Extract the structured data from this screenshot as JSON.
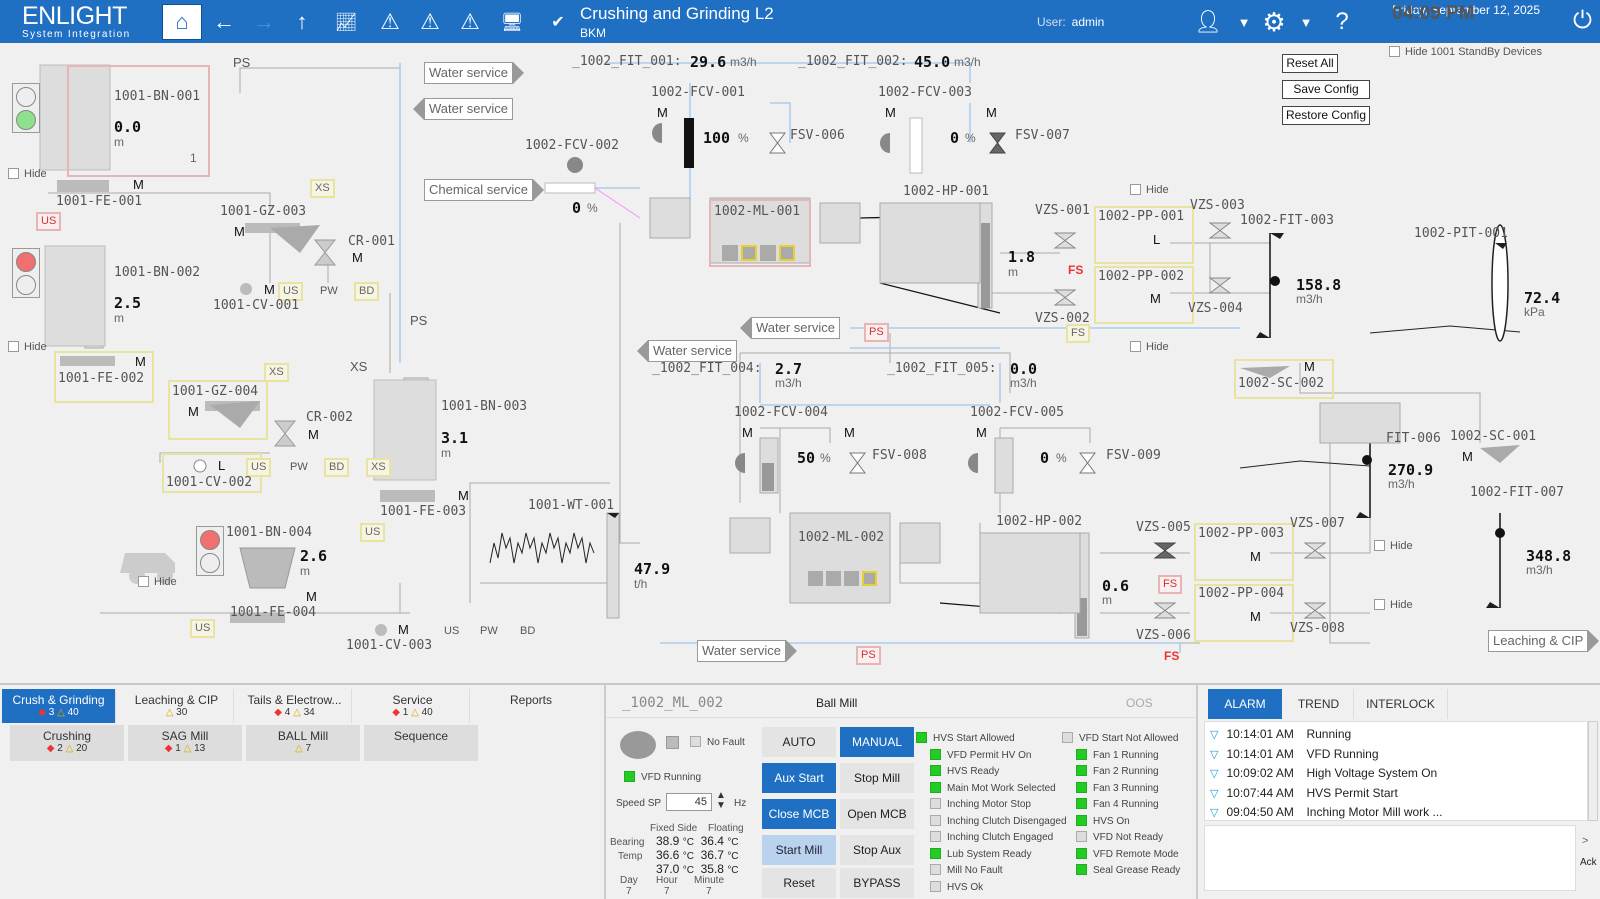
{
  "header": {
    "logo_main": "ENLIGHT",
    "logo_sub": "System Integration",
    "title": "Crushing and Grinding L2",
    "subtitle": "BKM",
    "user_label": "User:",
    "user_name": "admin",
    "time": "04:09 PM",
    "date": "Friday, September 12, 2025"
  },
  "right_controls": {
    "hide_standby": "Hide 1001 StandBy Devices",
    "reset_all": "Reset All",
    "save_config": "Save Config",
    "restore_config": "Restore Config"
  },
  "labels": {
    "ps": "PS",
    "xs": "XS",
    "us": "US",
    "pw": "PW",
    "bd": "BD",
    "fs": "FS",
    "m": "M",
    "l": "L",
    "hide": "Hide",
    "m_unit": "m",
    "one": "1",
    "water_service": "Water service",
    "chemical_service": "Chemical service",
    "leaching_cip": "Leaching & CIP",
    "pct": "%",
    "m3h": "m3/h",
    "kpa": "kPa",
    "th": "t/h"
  },
  "tags": {
    "bn001": "1001-BN-001",
    "bn002": "1001-BN-002",
    "bn003": "1001-BN-003",
    "bn004": "1001-BN-004",
    "fe001": "1001-FE-001",
    "fe002": "1001-FE-002",
    "fe003": "1001-FE-003",
    "fe004": "1001-FE-004",
    "gz003": "1001-GZ-003",
    "gz004": "1001-GZ-004",
    "cr001": "CR-001",
    "cr002": "CR-002",
    "cv001": "1001-CV-001",
    "cv002": "1001-CV-002",
    "cv003": "1001-CV-003",
    "wt001": "1001-WT-001",
    "fcv001": "1002-FCV-001",
    "fcv002": "1002-FCV-002",
    "fcv003": "1002-FCV-003",
    "fcv004": "1002-FCV-004",
    "fcv005": "1002-FCV-005",
    "fsv006": "FSV-006",
    "fsv007": "FSV-007",
    "fsv008": "FSV-008",
    "fsv009": "FSV-009",
    "ml001": "1002-ML-001",
    "ml002": "1002-ML-002",
    "hp001": "1002-HP-001",
    "hp002": "1002-HP-002",
    "pp001": "1002-PP-001",
    "pp002": "1002-PP-002",
    "pp003": "1002-PP-003",
    "pp004": "1002-PP-004",
    "vzs001": "VZS-001",
    "vzs002": "VZS-002",
    "vzs003": "VZS-003",
    "vzs004": "VZS-004",
    "vzs005": "VZS-005",
    "vzs006": "VZS-006",
    "vzs007": "VZS-007",
    "vzs008": "VZS-008",
    "fit003": "1002-FIT-003",
    "fit006": "FIT-006",
    "fit007": "1002-FIT-007",
    "pit001": "1002-PIT-001",
    "sc001": "1002-SC-001",
    "sc002": "1002-SC-002",
    "fit001": "_1002_FIT_001:",
    "fit002": "_1002_FIT_002:",
    "fit004": "_1002_FIT_004:",
    "fit005": "_1002_FIT_005:"
  },
  "values": {
    "bn001": "0.0",
    "bn002": "2.5",
    "bn003": "3.1",
    "bn004": "2.6",
    "fit001": "29.6",
    "fit002": "45.0",
    "fcv001": "100",
    "fcv002": "0",
    "fcv003": "0",
    "fcv004": "50",
    "fcv005": "0",
    "hp001": "1.8",
    "hp002": "0.6",
    "fit003": "158.8",
    "pit001": "72.4",
    "fit004": "2.7",
    "fit005": "0.0",
    "fit006": "270.9",
    "fit007": "348.8",
    "wt001": "47.9"
  },
  "bottom_tabs": [
    {
      "label": "Crush & Grinding",
      "red": "3",
      "yellow": "40"
    },
    {
      "label": "Leaching & CIP",
      "red": "",
      "yellow": "30"
    },
    {
      "label": "Tails & Electrow...",
      "red": "4",
      "yellow": "34"
    },
    {
      "label": "Service",
      "red": "1",
      "yellow": "40"
    },
    {
      "label": "Reports",
      "red": "",
      "yellow": ""
    }
  ],
  "sub_tabs": [
    {
      "label": "Crushing",
      "red": "2",
      "yellow": "20"
    },
    {
      "label": "SAG Mill",
      "red": "1",
      "yellow": "13"
    },
    {
      "label": "BALL Mill",
      "red": "",
      "yellow": "7"
    },
    {
      "label": "Sequence",
      "red": "",
      "yellow": ""
    }
  ],
  "mill_panel": {
    "tag": "_1002_ML_002",
    "name": "Ball Mill",
    "oos": "OOS",
    "no_fault": "No Fault",
    "vfd_running": "VFD Running",
    "speed_sp_label": "Speed SP",
    "speed_sp": "45",
    "hz": "Hz",
    "fixed_side": "Fixed Side",
    "floating": "Floating",
    "bearing": "Bearing",
    "temp": "Temp",
    "deg": "°C",
    "t1a": "38.9",
    "t1b": "36.4",
    "t2a": "36.6",
    "t2b": "36.7",
    "t3a": "37.0",
    "t3b": "35.8",
    "day": "Day",
    "hour": "Hour",
    "minute": "Minute",
    "day_v": "7",
    "hour_v": "7",
    "minute_v": "7"
  },
  "controls": {
    "auto": "AUTO",
    "manual": "MANUAL",
    "aux_start": "Aux Start",
    "stop_mill": "Stop Mill",
    "close_mcb": "Close MCB",
    "open_mcb": "Open MCB",
    "start_mill": "Start Mill",
    "stop_aux": "Stop Aux",
    "reset": "Reset",
    "bypass": "BYPASS"
  },
  "indicators_left": [
    {
      "label": "HVS Start Allowed",
      "on": true
    },
    {
      "label": "VFD Permit HV On",
      "on": true
    },
    {
      "label": "HVS Ready",
      "on": true
    },
    {
      "label": "Main Mot Work Selected",
      "on": true
    },
    {
      "label": "Inching Motor Stop",
      "on": false
    },
    {
      "label": "Inching Clutch Disengaged",
      "on": false
    },
    {
      "label": "Inching Clutch Engaged",
      "on": false
    },
    {
      "label": "Lub System Ready",
      "on": true
    },
    {
      "label": "Mill No Fault",
      "on": false
    },
    {
      "label": "HVS Ok",
      "on": false
    }
  ],
  "indicators_right": [
    {
      "label": "VFD Start Not Allowed",
      "on": false
    },
    {
      "label": "Fan 1 Running",
      "on": true
    },
    {
      "label": "Fan 2 Running",
      "on": true
    },
    {
      "label": "Fan 3 Running",
      "on": true
    },
    {
      "label": "Fan 4 Running",
      "on": true
    },
    {
      "label": "HVS On",
      "on": true
    },
    {
      "label": "VFD Not Ready",
      "on": false
    },
    {
      "label": "VFD Remote Mode",
      "on": true
    },
    {
      "label": "Seal Grease Ready",
      "on": true
    }
  ],
  "alarm_tabs": {
    "alarm": "ALARM",
    "trend": "TREND",
    "interlock": "INTERLOCK"
  },
  "alarms": [
    {
      "time": "10:14:01 AM",
      "text": "Running"
    },
    {
      "time": "10:14:01 AM",
      "text": "VFD Running"
    },
    {
      "time": "10:09:02 AM",
      "text": "High Voltage System On"
    },
    {
      "time": "10:07:44 AM",
      "text": "HVS Permit Start"
    },
    {
      "time": "09:04:50 AM",
      "text": "Inching Motor Mill work ..."
    }
  ],
  "ack": "Ack",
  "colors": {
    "header": "#1f6fc3",
    "alarm_red": "#e33333",
    "warning_yellow": "#e0a800",
    "running_green": "#22cc22"
  }
}
